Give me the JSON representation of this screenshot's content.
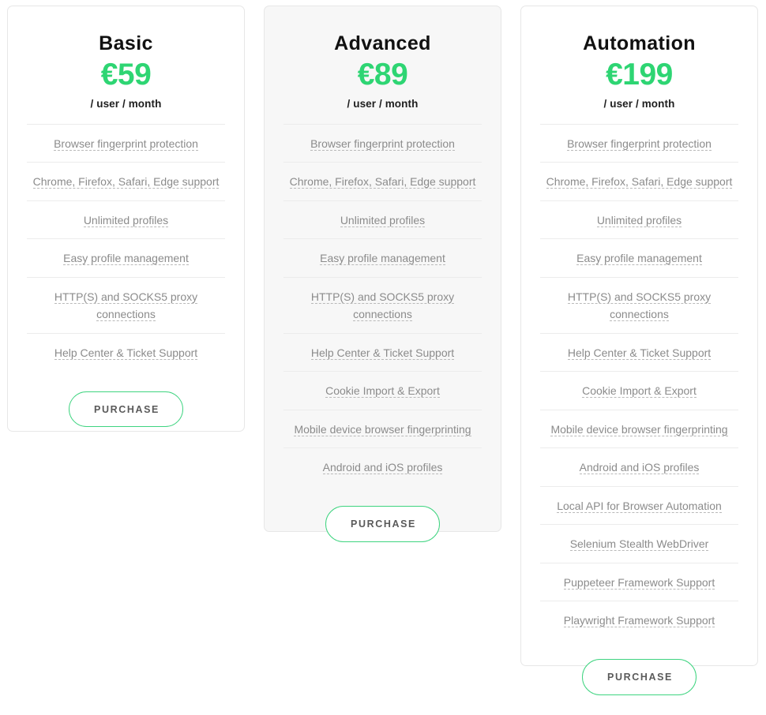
{
  "currency_symbol": "€",
  "colors": {
    "price_green": "#2ed573",
    "button_border_green": "#3fd480",
    "feature_text": "#8b8b8b",
    "divider": "#ececec",
    "card_border": "#e7e7e7",
    "highlight_card_bg": "#f7f7f7"
  },
  "plans": [
    {
      "name": "Basic",
      "price": "€59",
      "period": "/ user / month",
      "highlighted": false,
      "features": [
        "Browser fingerprint protection",
        "Chrome, Firefox, Safari, Edge support",
        "Unlimited profiles",
        "Easy profile management",
        "HTTP(S) and SOCKS5 proxy connections",
        "Help Center & Ticket Support"
      ],
      "cta_label": "PURCHASE"
    },
    {
      "name": "Advanced",
      "price": "€89",
      "period": "/ user / month",
      "highlighted": true,
      "features": [
        "Browser fingerprint protection",
        "Chrome, Firefox, Safari, Edge support",
        "Unlimited profiles",
        "Easy profile management",
        "HTTP(S) and SOCKS5 proxy connections",
        "Help Center & Ticket Support",
        "Cookie Import & Export",
        "Mobile device browser fingerprinting",
        "Android and iOS profiles"
      ],
      "cta_label": "PURCHASE"
    },
    {
      "name": "Automation",
      "price": "€199",
      "period": "/ user / month",
      "highlighted": false,
      "features": [
        "Browser fingerprint protection",
        "Chrome, Firefox, Safari, Edge support",
        "Unlimited profiles",
        "Easy profile management",
        "HTTP(S) and SOCKS5 proxy connections",
        "Help Center & Ticket Support",
        "Cookie Import & Export",
        "Mobile device browser fingerprinting",
        "Android and iOS profiles",
        "Local API for Browser Automation",
        "Selenium Stealth WebDriver",
        "Puppeteer Framework Support",
        "Playwright Framework Support"
      ],
      "cta_label": "PURCHASE"
    }
  ]
}
